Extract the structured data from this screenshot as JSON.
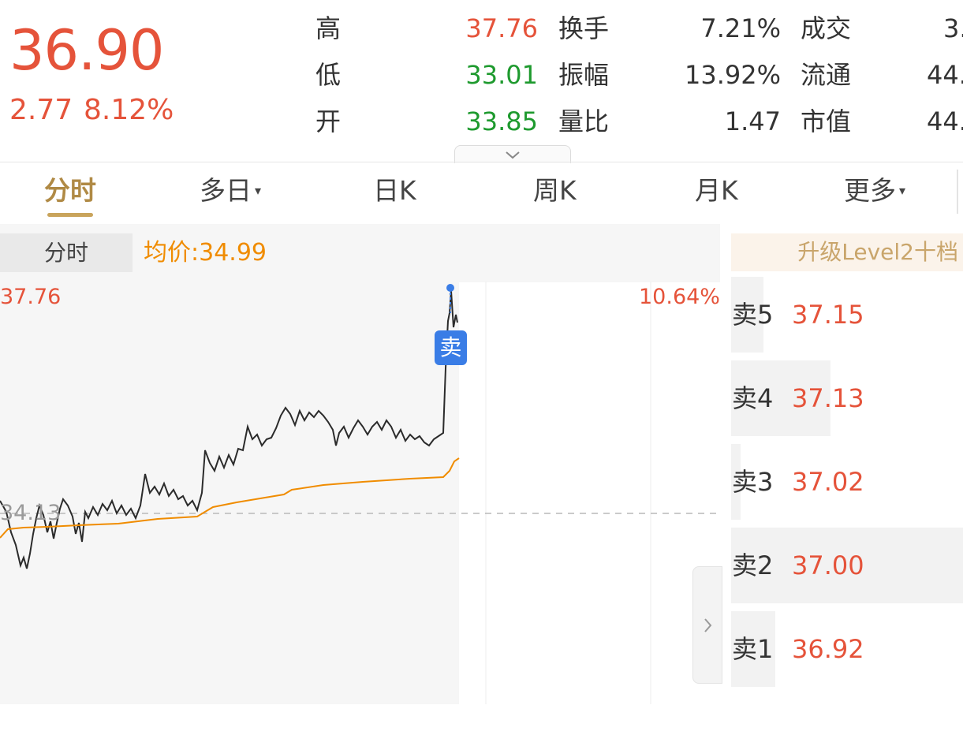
{
  "quote": {
    "price": "36.90",
    "change": "2.77",
    "change_pct": "8.12%"
  },
  "stats": [
    {
      "label": "高",
      "value": "37.76",
      "label2": "换手",
      "value2": "7.21%",
      "label3": "成交",
      "value3": "3."
    },
    {
      "label": "低",
      "value": "33.01",
      "label2": "振幅",
      "value2": "13.92%",
      "label3": "流通",
      "value3": "44."
    },
    {
      "label": "开",
      "value": "33.85",
      "label2": "量比",
      "value2": "1.47",
      "label3": "市值",
      "value3": "44."
    }
  ],
  "tabs": [
    {
      "label": "分时"
    },
    {
      "label": "多日",
      "dropdown_mark": "▾"
    },
    {
      "label": "日K"
    },
    {
      "label": "周K"
    },
    {
      "label": "月K"
    },
    {
      "label": "更多",
      "dropdown_mark": "▾"
    }
  ],
  "chart_header": {
    "mode_label": "分时",
    "avg_price": "均价:34.99"
  },
  "axis": {
    "high_price": "37.76",
    "high_pct": "10.64%",
    "prev_close": "34.13"
  },
  "marker": {
    "label": "卖"
  },
  "level2_button": "升级Level2十档",
  "order_book": [
    {
      "label": "卖5",
      "price": "37.15",
      "volume_share": 0.14
    },
    {
      "label": "卖4",
      "price": "37.13",
      "volume_share": 0.43
    },
    {
      "label": "卖3",
      "price": "37.02",
      "volume_share": 0.04
    },
    {
      "label": "卖2",
      "price": "37.00",
      "volume_share": 1.0
    },
    {
      "label": "卖1",
      "price": "36.92",
      "volume_share": 0.19
    }
  ],
  "icons": {
    "expand": "chevron-down-icon",
    "side_panel": "chevron-right-icon"
  },
  "colors": {
    "up": "#e5533a",
    "down": "#1e9a2e",
    "avg_line": "#f08c00",
    "active_tab": "#b08a45",
    "marker": "#3a7de6"
  }
}
